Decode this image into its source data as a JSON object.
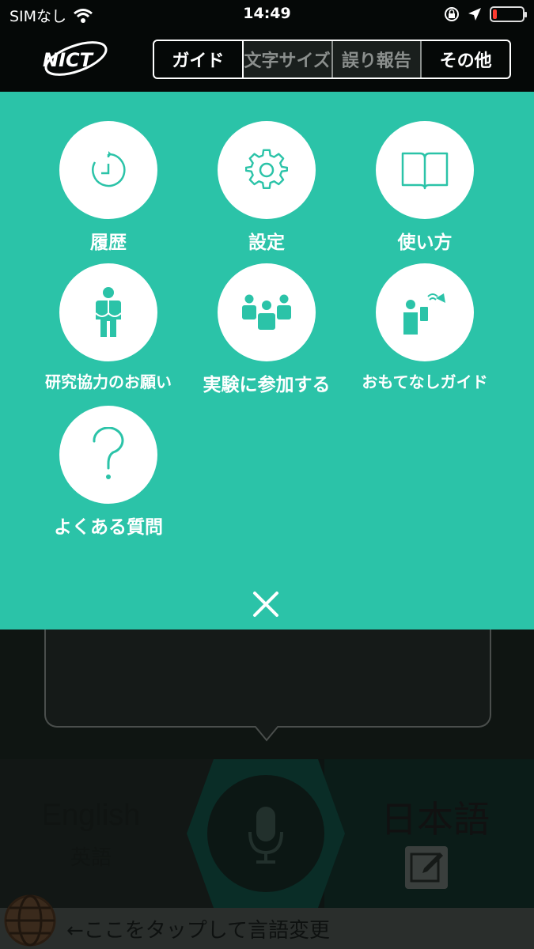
{
  "status_bar": {
    "carrier": "SIMなし",
    "time": "14:49",
    "battery_level": 0.15
  },
  "header": {
    "logo_text": "NICT",
    "tabs": [
      {
        "label": "ガイド",
        "state": "active"
      },
      {
        "label": "文字サイズ",
        "state": "dim"
      },
      {
        "label": "誤り報告",
        "state": "dim"
      },
      {
        "label": "その他",
        "state": "active"
      }
    ]
  },
  "menu": {
    "items": [
      {
        "label": "履歴",
        "icon": "history-icon"
      },
      {
        "label": "設定",
        "icon": "gear-icon"
      },
      {
        "label": "使い方",
        "icon": "book-icon"
      },
      {
        "label": "研究協力のお願い",
        "icon": "person-icon"
      },
      {
        "label": "実験に参加する",
        "icon": "group-icon"
      },
      {
        "label": "おもてなしガイド",
        "icon": "guide-icon"
      },
      {
        "label": "よくある質問",
        "icon": "question-icon"
      }
    ],
    "close_icon": "close-icon"
  },
  "background_app": {
    "source_language": "English",
    "source_language_sub": "英語",
    "target_language": "日本語",
    "mic_icon": "microphone-icon",
    "edit_icon": "edit-icon",
    "globe_icon": "globe-icon",
    "footer_hint": "←ここをタップして言語変更"
  },
  "colors": {
    "accent": "#2bc3a8",
    "header_bg": "#050807"
  }
}
